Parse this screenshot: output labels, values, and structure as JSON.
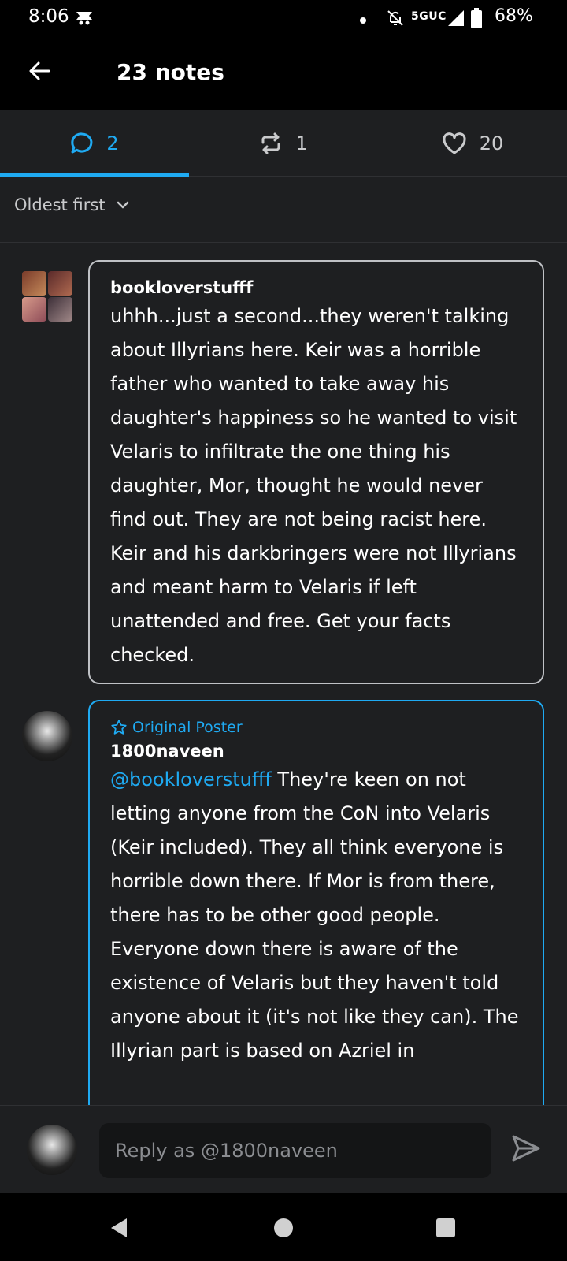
{
  "status_bar": {
    "time": "8:06",
    "network": "5GUC",
    "battery": "68%",
    "icons": [
      "notification-app-icon",
      "dot-icon",
      "bell-off-icon",
      "signal-icon",
      "battery-icon"
    ]
  },
  "header": {
    "title": "23 notes",
    "back_icon": "arrow-left-icon"
  },
  "tabs": [
    {
      "icon": "comment-icon",
      "count": "2",
      "active": true
    },
    {
      "icon": "reblog-icon",
      "count": "1",
      "active": false
    },
    {
      "icon": "heart-icon",
      "count": "20",
      "active": false
    }
  ],
  "sort": {
    "label": "Oldest first",
    "icon": "chevron-down-icon"
  },
  "comments": [
    {
      "username": "bookloverstufff",
      "body": "uhhh...just a second...they weren't talking about Illyrians here. Keir was a horrible father who wanted to take away his daughter's happiness so he wanted to visit Velaris to infiltrate the one thing his daughter, Mor, thought he would never find out. They are not being racist here. Keir and his darkbringers were not Illyrians and meant harm to Velaris if left unattended and free. Get your facts checked."
    },
    {
      "badge": "Original Poster",
      "username": "1800naveen",
      "mention": "@bookloverstufff",
      "body": " They're keen on not letting anyone from the CoN into Velaris (Keir included). They all think everyone is horrible down there. If Mor is from there, there has to be other good people. Everyone down there is aware of the existence of Velaris but they haven't told anyone about it (it's not like they can). The Illyrian part is based on Azriel in"
    }
  ],
  "reply": {
    "placeholder": "Reply as @1800naveen",
    "send_icon": "send-icon"
  },
  "colors": {
    "accent": "#1faaf2",
    "background": "#1e1f21",
    "bar": "#000000"
  }
}
